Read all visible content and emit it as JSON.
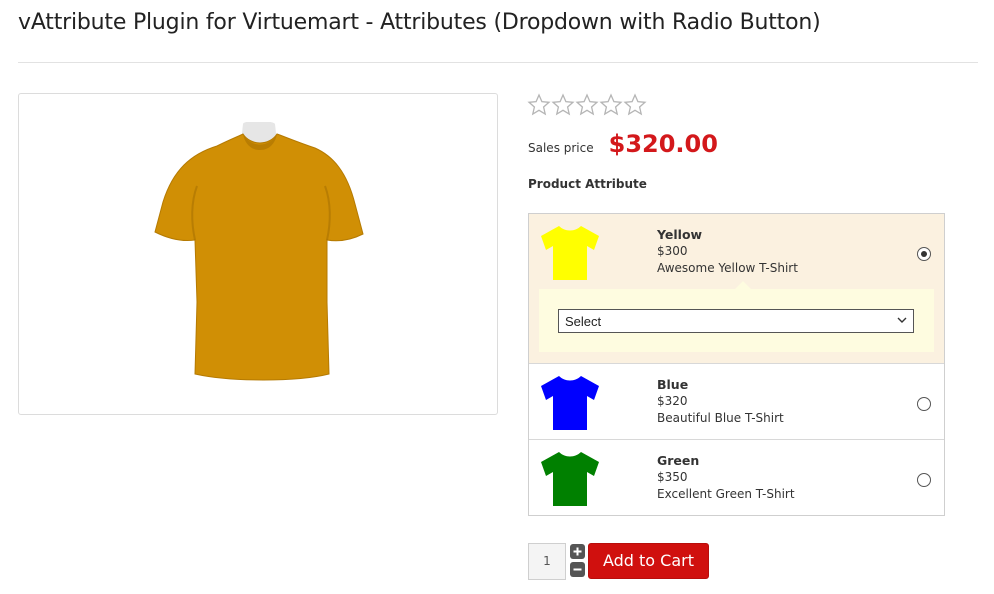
{
  "page": {
    "title": "vAttribute Plugin for Virtuemart - Attributes (Dropdown with Radio Button)"
  },
  "product": {
    "image_color": "#d08f05",
    "rating_stars": 0,
    "rating_max": 5,
    "price_label": "Sales price",
    "price_value": "$320.00",
    "price_color": "#d3181b"
  },
  "attributes": {
    "heading": "Product Attribute",
    "options": [
      {
        "name": "Yellow",
        "price": "$300",
        "description": "Awesome Yellow T-Shirt",
        "color": "#ffff00",
        "selected": true,
        "dropdown": {
          "value": "Select"
        }
      },
      {
        "name": "Blue",
        "price": "$320",
        "description": "Beautiful Blue T-Shirt",
        "color": "#0000ff",
        "selected": false
      },
      {
        "name": "Green",
        "price": "$350",
        "description": "Excellent Green T-Shirt",
        "color": "#008000",
        "selected": false
      }
    ]
  },
  "cart": {
    "quantity": "1",
    "plus_icon": "plus-icon",
    "minus_icon": "minus-icon",
    "add_label": "Add to Cart",
    "button_color": "#d0100e"
  }
}
